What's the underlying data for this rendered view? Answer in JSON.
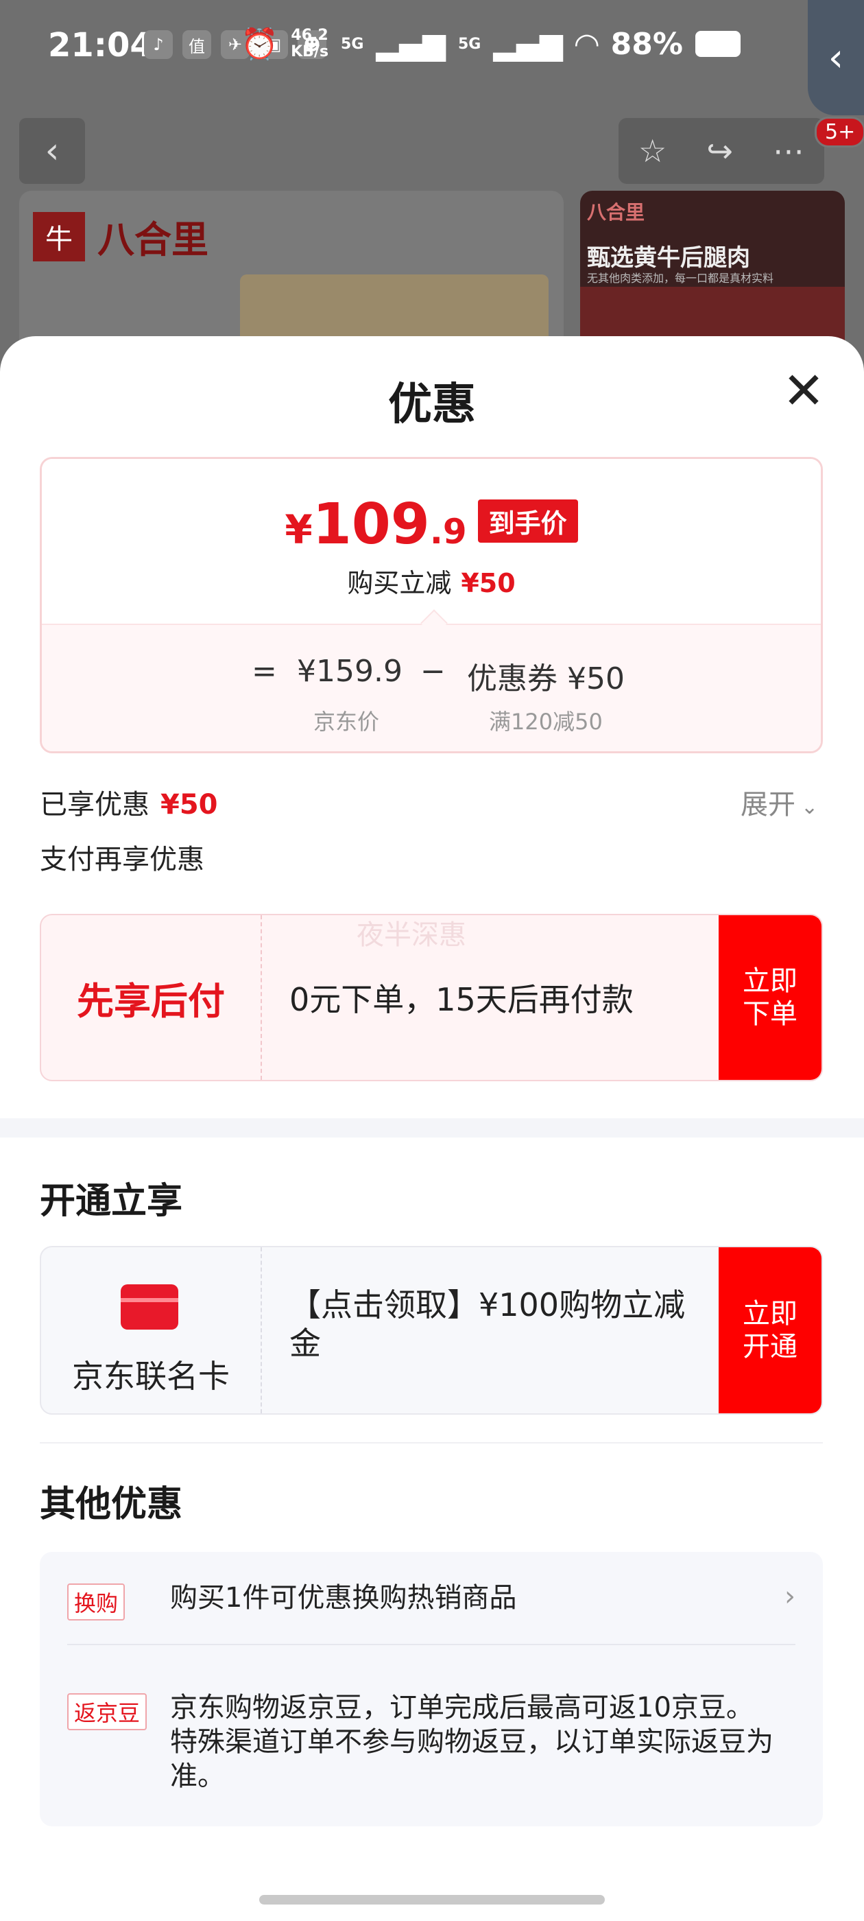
{
  "status_bar": {
    "time": "21:04",
    "net_speed_value": "46.2",
    "net_speed_unit": "KB/s",
    "sim1": "5G",
    "sim2": "5G",
    "battery": "88%"
  },
  "background": {
    "notification_count": "5+",
    "brand_name": "八合里",
    "promo_brand": "八合里",
    "promo_title": "甄选黄牛后腿肉",
    "promo_subtitle": "无其他肉类添加，每一口都是真材实料"
  },
  "sheet": {
    "title": "优惠",
    "close_label": "✕"
  },
  "price_box": {
    "currency": "¥",
    "price_int": "109",
    "price_dec": ".9",
    "price_tag": "到手价",
    "sub_label": "购买立减",
    "sub_amount": "¥50",
    "equals": "=",
    "jd_price": "¥159.9",
    "minus": "−",
    "coupon": "优惠券 ¥50",
    "jd_price_label": "京东价",
    "coupon_rule": "满120减50"
  },
  "savings": {
    "label": "已享优惠",
    "amount": "¥50",
    "expand_label": "展开",
    "pay_heading": "支付再享优惠"
  },
  "bnpl": {
    "title": "先享后付",
    "description": "0元下单，15天后再付款",
    "watermark": "夜半深惠",
    "button": "立即\n下单"
  },
  "open_section": {
    "title": "开通立享",
    "card_name": "京东联名卡",
    "card_desc": "【点击领取】¥100购物立减金",
    "button": "立即\n开通"
  },
  "other_section": {
    "title": "其他优惠",
    "items": [
      {
        "tag": "换购",
        "text": "购买1件可优惠换购热销商品"
      },
      {
        "tag": "返京豆",
        "text": "京东购物返京豆，订单完成后最高可返10京豆。特殊渠道订单不参与购物返豆，以订单实际返豆为准。"
      }
    ]
  },
  "colors": {
    "accent_red": "#e4151e",
    "button_red": "#fe0000"
  }
}
